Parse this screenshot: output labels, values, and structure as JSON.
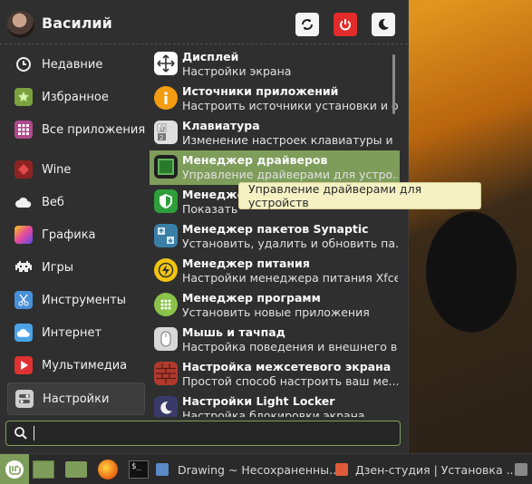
{
  "user": {
    "name": "Василий"
  },
  "header": {
    "icons": [
      "sync-icon",
      "power-icon",
      "moon-icon"
    ]
  },
  "sidebar": {
    "items": [
      {
        "label": "Недавние",
        "icon": "clock-icon",
        "color": "#e0e0e0"
      },
      {
        "label": "Избранное",
        "icon": "star-folder-icon",
        "color": "#7aa33f"
      },
      {
        "label": "Все приложения",
        "icon": "grid-icon",
        "color": "#b04a8c"
      },
      {
        "label": "Wine",
        "icon": "wine-icon",
        "color": "#c0392b"
      },
      {
        "label": "Веб",
        "icon": "cloud-icon",
        "color": "#e8e8e8"
      },
      {
        "label": "Графика",
        "icon": "palette-icon",
        "color": "#d04ad0"
      },
      {
        "label": "Игры",
        "icon": "space-invader-icon",
        "color": "#e0e0e0"
      },
      {
        "label": "Инструменты",
        "icon": "scissors-icon",
        "color": "#4a90d9"
      },
      {
        "label": "Интернет",
        "icon": "cloud-blue-icon",
        "color": "#4aa3e8"
      },
      {
        "label": "Мультимедиа",
        "icon": "play-icon",
        "color": "#e03232"
      },
      {
        "label": "Настройки",
        "icon": "toggles-icon",
        "color": "#cfcfcf"
      }
    ]
  },
  "apps": [
    {
      "title": "Дисплей",
      "desc": "Настройки экрана",
      "icon": "display-arrows-icon",
      "color": "#ffffff"
    },
    {
      "title": "Источники приложений",
      "desc": "Настроить источники установки и обн...",
      "icon": "info-icon",
      "color": "#f39c12"
    },
    {
      "title": "Клавиатура",
      "desc": "Изменение настроек клавиатуры и ...",
      "icon": "keyboard-icon",
      "color": "#e0e0e0"
    },
    {
      "title": "Менеджер драйверов",
      "desc": "Управление драйверами для устро...",
      "icon": "chip-icon",
      "color": "#2b6e2b"
    },
    {
      "title": "Менеджер",
      "desc": "Показать",
      "icon": "shield-icon",
      "color": "#2e9e3a"
    },
    {
      "title": "Менеджер пакетов Synaptic",
      "desc": "Установить, удалить и обновить па...",
      "icon": "package-arrows-icon",
      "color": "#3a7fa8"
    },
    {
      "title": "Менеджер питания",
      "desc": "Настройки менеджера питания Xfce",
      "icon": "lightning-icon",
      "color": "#f1c40f"
    },
    {
      "title": "Менеджер программ",
      "desc": "Установить новые приложения",
      "icon": "app-grid-icon",
      "color": "#8bc34a"
    },
    {
      "title": "Мышь и тачпад",
      "desc": "Настройка поведения и внешнего в...",
      "icon": "mouse-icon",
      "color": "#d8d8d8"
    },
    {
      "title": "Настройка межсетевого экрана",
      "desc": "Простой способ настроить ваш ме...",
      "icon": "brick-wall-icon",
      "color": "#b03a2e"
    },
    {
      "title": "Настройки Light Locker",
      "desc": "Настройка блокировки экрана",
      "icon": "moon-lock-icon",
      "color": "#3a3a6a"
    }
  ],
  "tooltip": {
    "text": "Управление драйверами для устройств"
  },
  "search": {
    "value": ""
  },
  "taskbar": {
    "windows": [
      {
        "title": "Drawing ~ Несохраненны..."
      },
      {
        "title": "Дзен-студия | Установка ..."
      }
    ]
  },
  "colors": {
    "accent": "#7e9d5b",
    "menu_bg": "#2f2f2f"
  }
}
